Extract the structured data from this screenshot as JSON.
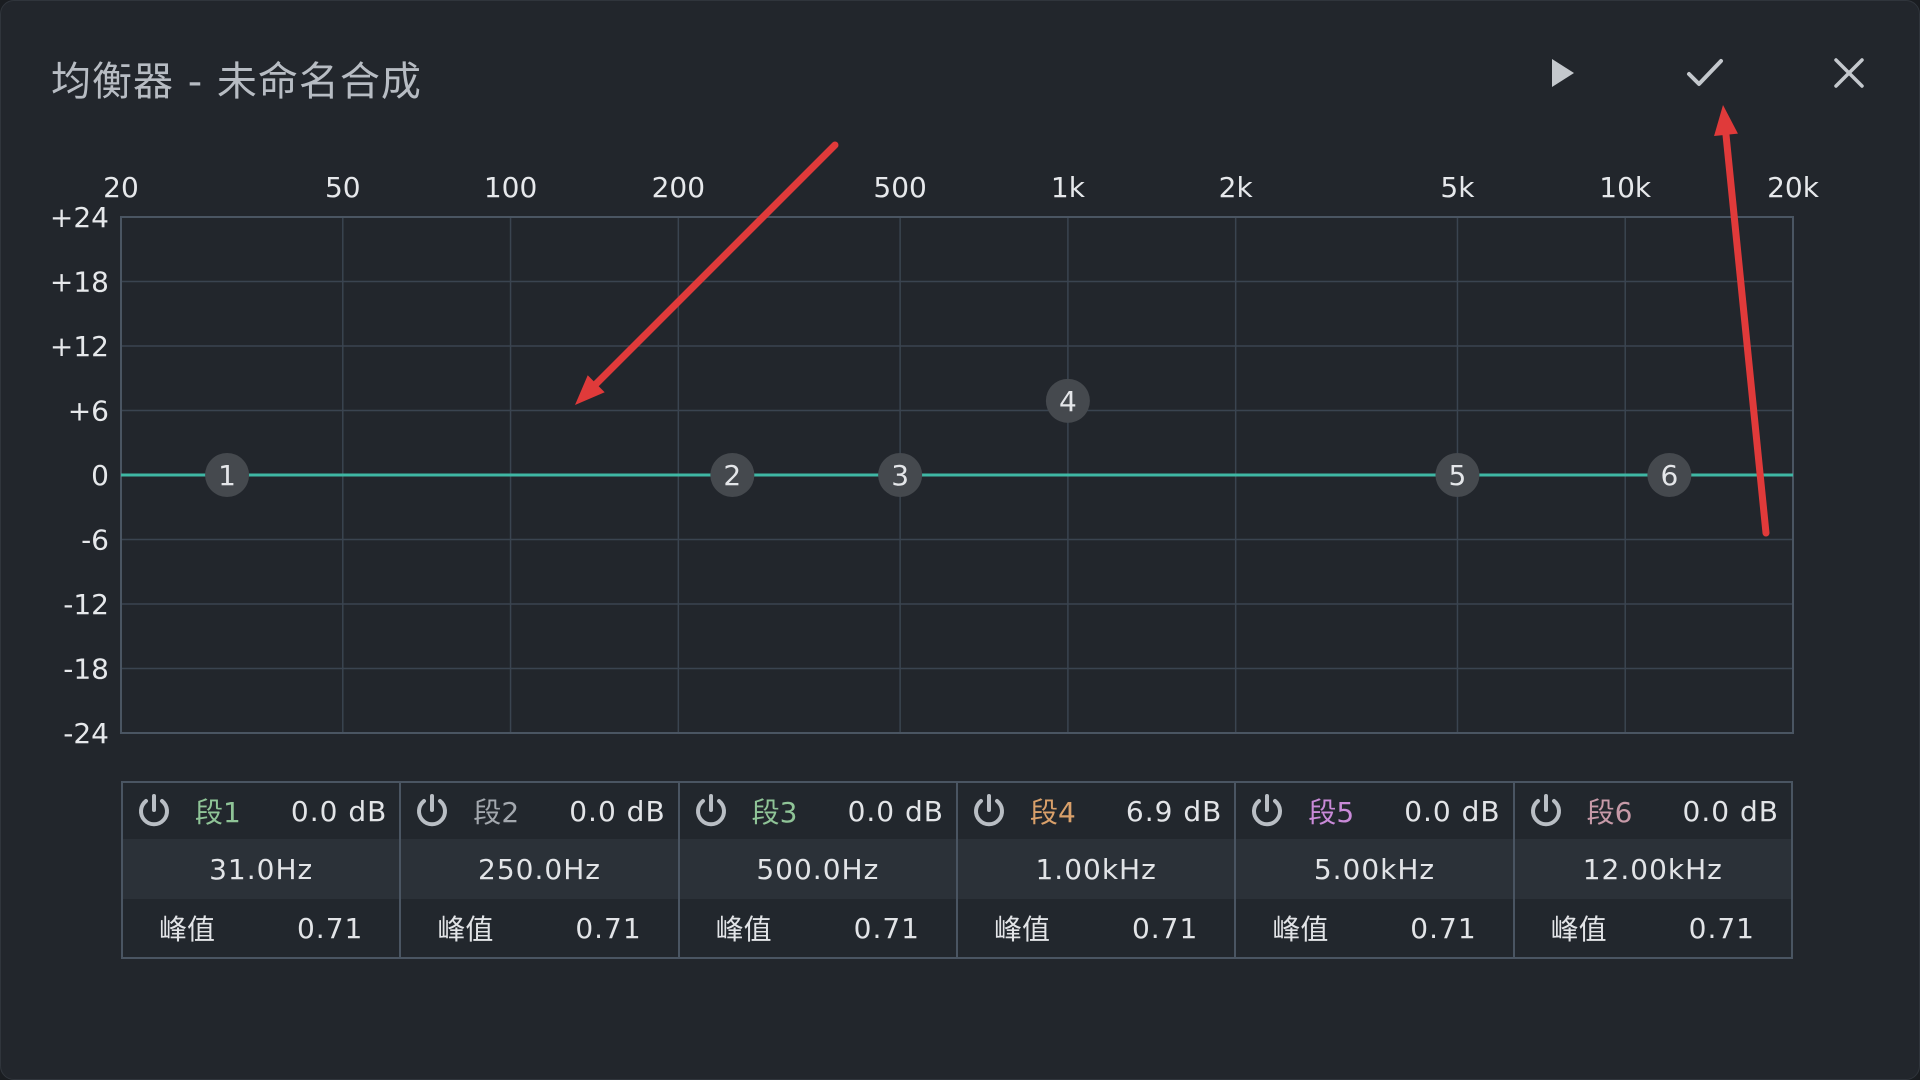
{
  "dialog": {
    "title": "均衡器 - 未命名合成"
  },
  "toolbar": {
    "icons": [
      "play-icon",
      "check-icon",
      "close-icon"
    ]
  },
  "graph": {
    "x_tick_labels": [
      "20",
      "50",
      "100",
      "200",
      "500",
      "1k",
      "2k",
      "5k",
      "10k",
      "20k"
    ],
    "x_tick_values": [
      20,
      50,
      100,
      200,
      500,
      1000,
      2000,
      5000,
      10000,
      20000
    ],
    "y_tick_labels": [
      "+24",
      "+18",
      "+12",
      "+6",
      "0",
      "-6",
      "-12",
      "-18",
      "-24"
    ],
    "y_tick_values": [
      24,
      18,
      12,
      6,
      0,
      -6,
      -12,
      -18,
      -24
    ],
    "x_range": [
      20,
      20000
    ],
    "y_range": [
      -24,
      24
    ],
    "x_scale": "log",
    "curve_gain_db": 0,
    "colors": {
      "curve": "#3fb7a4",
      "grid": "#3a4450",
      "node_fill": "#45494e"
    },
    "nodes": [
      {
        "label": "1",
        "freq_hz": 31,
        "gain_db": 0
      },
      {
        "label": "2",
        "freq_hz": 250,
        "gain_db": 0
      },
      {
        "label": "3",
        "freq_hz": 500,
        "gain_db": 0
      },
      {
        "label": "4",
        "freq_hz": 1000,
        "gain_db": 6.9
      },
      {
        "label": "5",
        "freq_hz": 5000,
        "gain_db": 0
      },
      {
        "label": "6",
        "freq_hz": 12000,
        "gain_db": 0
      }
    ]
  },
  "bands": [
    {
      "name": "段1",
      "gain": "0.0 dB",
      "freq": "31.0Hz",
      "q_label": "峰值",
      "q": "0.71",
      "color": "#8fc497"
    },
    {
      "name": "段2",
      "gain": "0.0 dB",
      "freq": "250.0Hz",
      "q_label": "峰值",
      "q": "0.71",
      "color": "#a3a8ae"
    },
    {
      "name": "段3",
      "gain": "0.0 dB",
      "freq": "500.0Hz",
      "q_label": "峰值",
      "q": "0.71",
      "color": "#8fc497"
    },
    {
      "name": "段4",
      "gain": "6.9 dB",
      "freq": "1.00kHz",
      "q_label": "峰值",
      "q": "0.71",
      "color": "#d9a06a"
    },
    {
      "name": "段5",
      "gain": "0.0 dB",
      "freq": "5.00kHz",
      "q_label": "峰值",
      "q": "0.71",
      "color": "#c98ad8"
    },
    {
      "name": "段6",
      "gain": "0.0 dB",
      "freq": "12.00kHz",
      "q_label": "峰值",
      "q": "0.71",
      "color": "#c79aa8"
    }
  ],
  "annotations": {
    "arrow_color": "#e03a3a"
  }
}
